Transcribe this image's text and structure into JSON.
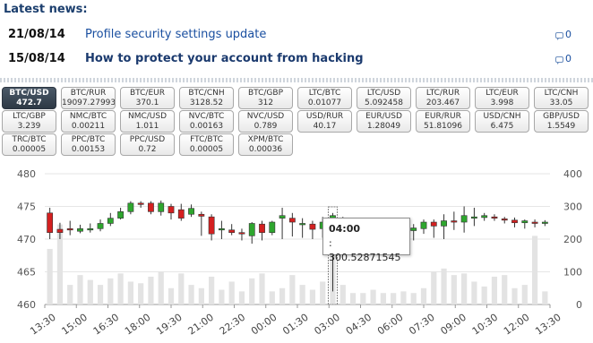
{
  "news": {
    "title": "Latest news:",
    "items": [
      {
        "date": "21/08/14",
        "headline": "Profile security settings update",
        "comments": "0",
        "bold": false
      },
      {
        "date": "15/08/14",
        "headline": "How to protect your account from hacking",
        "comments": "0",
        "bold": true
      }
    ]
  },
  "pairs": [
    {
      "name": "BTC/USD",
      "value": "472.7",
      "active": true
    },
    {
      "name": "BTC/RUR",
      "value": "19097.27993"
    },
    {
      "name": "BTC/EUR",
      "value": "370.1"
    },
    {
      "name": "BTC/CNH",
      "value": "3128.52"
    },
    {
      "name": "BTC/GBP",
      "value": "312"
    },
    {
      "name": "LTC/BTC",
      "value": "0.01077"
    },
    {
      "name": "LTC/USD",
      "value": "5.092458"
    },
    {
      "name": "LTC/RUR",
      "value": "203.467"
    },
    {
      "name": "LTC/EUR",
      "value": "3.998"
    },
    {
      "name": "LTC/CNH",
      "value": "33.05"
    },
    {
      "name": "LTC/GBP",
      "value": "3.239"
    },
    {
      "name": "NMC/BTC",
      "value": "0.00211"
    },
    {
      "name": "NMC/USD",
      "value": "1.011"
    },
    {
      "name": "NVC/BTC",
      "value": "0.00163"
    },
    {
      "name": "NVC/USD",
      "value": "0.789"
    },
    {
      "name": "USD/RUR",
      "value": "40.17"
    },
    {
      "name": "EUR/USD",
      "value": "1.28049"
    },
    {
      "name": "EUR/RUR",
      "value": "51.81096"
    },
    {
      "name": "USD/CNH",
      "value": "6.475"
    },
    {
      "name": "GBP/USD",
      "value": "1.5549"
    },
    {
      "name": "TRC/BTC",
      "value": "0.00005"
    },
    {
      "name": "PPC/BTC",
      "value": "0.00153"
    },
    {
      "name": "PPC/USD",
      "value": "0.72"
    },
    {
      "name": "FTC/BTC",
      "value": "0.00005"
    },
    {
      "name": "XPM/BTC",
      "value": "0.00036"
    }
  ],
  "chart_data": {
    "type": "candlestick",
    "y_price_ticks": [
      "480",
      "475",
      "470",
      "465",
      "460"
    ],
    "y_volume_ticks": [
      "400",
      "300",
      "200",
      "100",
      "0"
    ],
    "price_range": [
      460,
      480
    ],
    "volume_range": [
      0,
      400
    ],
    "x_ticks": [
      "13:30",
      "15:00",
      "16:30",
      "18:00",
      "19:30",
      "21:00",
      "22:30",
      "00:00",
      "01:30",
      "03:00",
      "04:30",
      "06:00",
      "07:30",
      "09:00",
      "10:30",
      "12:00",
      "13:30"
    ],
    "grid": true,
    "up_color": "#2ea62e",
    "down_color": "#d42020",
    "volume_color": "#e3e3e3",
    "candles": [
      {
        "o": 474.0,
        "c": 471.0,
        "h": 474.8,
        "l": 470.0,
        "v": 170
      },
      {
        "o": 471.5,
        "c": 471.0,
        "h": 472.5,
        "l": 470.0,
        "v": 245
      },
      {
        "o": 471.6,
        "c": 471.5,
        "h": 472.8,
        "l": 470.6,
        "v": 60
      },
      {
        "o": 471.2,
        "c": 471.6,
        "h": 472.2,
        "l": 470.9,
        "v": 90
      },
      {
        "o": 471.4,
        "c": 471.6,
        "h": 472.4,
        "l": 471.0,
        "v": 75
      },
      {
        "o": 471.6,
        "c": 472.4,
        "h": 473.0,
        "l": 471.2,
        "v": 60
      },
      {
        "o": 472.4,
        "c": 473.2,
        "h": 474.0,
        "l": 472.0,
        "v": 80
      },
      {
        "o": 473.2,
        "c": 474.2,
        "h": 474.8,
        "l": 473.0,
        "v": 95
      },
      {
        "o": 474.2,
        "c": 475.5,
        "h": 475.8,
        "l": 473.8,
        "v": 70
      },
      {
        "o": 475.5,
        "c": 475.3,
        "h": 475.8,
        "l": 474.8,
        "v": 65
      },
      {
        "o": 475.5,
        "c": 474.2,
        "h": 475.8,
        "l": 473.8,
        "v": 85
      },
      {
        "o": 474.2,
        "c": 475.5,
        "h": 475.9,
        "l": 473.6,
        "v": 100
      },
      {
        "o": 475.0,
        "c": 474.0,
        "h": 475.4,
        "l": 473.0,
        "v": 50
      },
      {
        "o": 474.5,
        "c": 473.2,
        "h": 475.4,
        "l": 472.8,
        "v": 95
      },
      {
        "o": 473.8,
        "c": 474.7,
        "h": 475.3,
        "l": 473.4,
        "v": 60
      },
      {
        "o": 473.8,
        "c": 473.5,
        "h": 474.2,
        "l": 470.5,
        "v": 50
      },
      {
        "o": 473.4,
        "c": 470.8,
        "h": 473.8,
        "l": 469.8,
        "v": 85
      },
      {
        "o": 471.6,
        "c": 471.6,
        "h": 472.8,
        "l": 470.0,
        "v": 45
      },
      {
        "o": 471.4,
        "c": 471.0,
        "h": 472.3,
        "l": 470.6,
        "v": 70
      },
      {
        "o": 471.0,
        "c": 470.8,
        "h": 471.6,
        "l": 469.8,
        "v": 40
      },
      {
        "o": 470.5,
        "c": 472.4,
        "h": 472.6,
        "l": 469.3,
        "v": 80
      },
      {
        "o": 472.3,
        "c": 471.0,
        "h": 472.8,
        "l": 469.8,
        "v": 95
      },
      {
        "o": 471.0,
        "c": 472.6,
        "h": 472.8,
        "l": 470.6,
        "v": 40
      },
      {
        "o": 473.2,
        "c": 473.6,
        "h": 474.8,
        "l": 470.0,
        "v": 50
      },
      {
        "o": 473.2,
        "c": 472.6,
        "h": 474.0,
        "l": 470.4,
        "v": 90
      },
      {
        "o": 472.2,
        "c": 472.4,
        "h": 473.2,
        "l": 470.2,
        "v": 60
      },
      {
        "o": 472.3,
        "c": 471.5,
        "h": 472.8,
        "l": 470.0,
        "v": 45
      },
      {
        "o": 471.6,
        "c": 472.6,
        "h": 473.4,
        "l": 470.2,
        "v": 70
      },
      {
        "o": 472.6,
        "c": 473.6,
        "h": 474.0,
        "l": 462.0,
        "v": 220
      },
      {
        "o": 473.2,
        "c": 472.7,
        "h": 473.4,
        "l": 471.0,
        "v": 60
      },
      {
        "o": 472.6,
        "c": 471.5,
        "h": 472.8,
        "l": 470.4,
        "v": 35
      },
      {
        "o": 471.5,
        "c": 471.7,
        "h": 472.4,
        "l": 470.8,
        "v": 35
      },
      {
        "o": 471.6,
        "c": 471.4,
        "h": 472.8,
        "l": 470.8,
        "v": 45
      },
      {
        "o": 471.4,
        "c": 471.6,
        "h": 472.2,
        "l": 470.8,
        "v": 35
      },
      {
        "o": 471.5,
        "c": 471.6,
        "h": 472.2,
        "l": 470.4,
        "v": 35
      },
      {
        "o": 471.6,
        "c": 471.3,
        "h": 472.4,
        "l": 470.6,
        "v": 40
      },
      {
        "o": 471.3,
        "c": 471.7,
        "h": 472.3,
        "l": 469.8,
        "v": 35
      },
      {
        "o": 471.6,
        "c": 472.6,
        "h": 473.0,
        "l": 470.8,
        "v": 50
      },
      {
        "o": 472.6,
        "c": 472.0,
        "h": 473.0,
        "l": 470.2,
        "v": 100
      },
      {
        "o": 472.0,
        "c": 472.8,
        "h": 473.8,
        "l": 470.0,
        "v": 110
      },
      {
        "o": 472.8,
        "c": 472.6,
        "h": 474.2,
        "l": 471.4,
        "v": 90
      },
      {
        "o": 472.6,
        "c": 473.6,
        "h": 475.0,
        "l": 471.0,
        "v": 95
      },
      {
        "o": 473.4,
        "c": 473.4,
        "h": 474.8,
        "l": 472.0,
        "v": 70
      },
      {
        "o": 473.3,
        "c": 473.6,
        "h": 474.0,
        "l": 472.8,
        "v": 55
      },
      {
        "o": 473.4,
        "c": 473.2,
        "h": 473.8,
        "l": 472.8,
        "v": 85
      },
      {
        "o": 473.1,
        "c": 472.9,
        "h": 473.4,
        "l": 472.4,
        "v": 90
      },
      {
        "o": 472.9,
        "c": 472.5,
        "h": 473.3,
        "l": 471.8,
        "v": 50
      },
      {
        "o": 472.5,
        "c": 472.8,
        "h": 473.0,
        "l": 471.6,
        "v": 60
      },
      {
        "o": 472.6,
        "c": 472.4,
        "h": 473.0,
        "l": 471.8,
        "v": 210
      },
      {
        "o": 472.5,
        "c": 472.6,
        "h": 472.9,
        "l": 472.0,
        "v": 40
      }
    ],
    "tooltip": {
      "time": "04:00",
      "value": ": 300.52871545",
      "index": 28
    }
  }
}
